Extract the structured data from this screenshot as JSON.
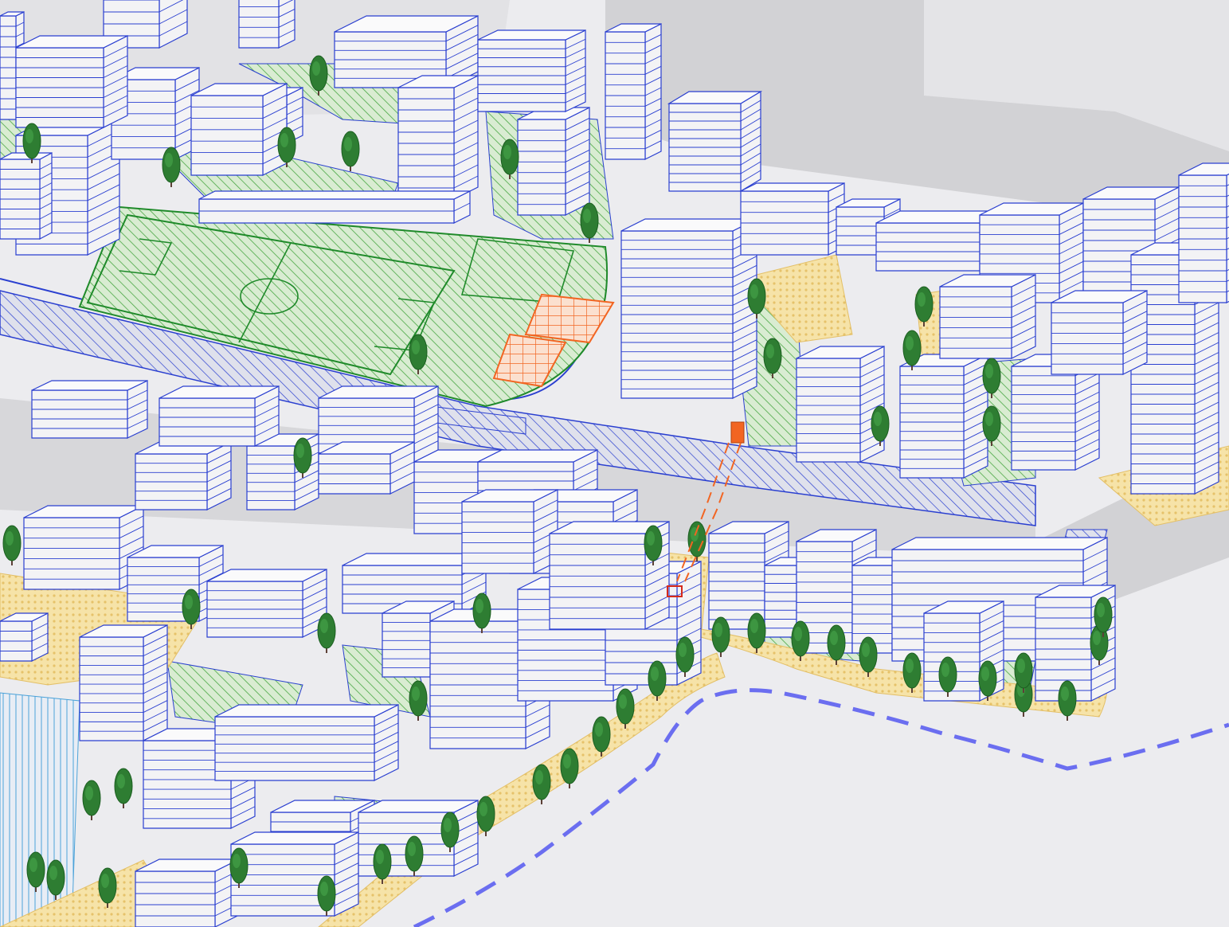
{
  "title": "",
  "colors": {
    "background": "#ececef",
    "ground_shadow": "#c9c9cc",
    "building_fill": "#f3f3f5",
    "building_roof": "#fafafb",
    "building_line": "#2a3fd0",
    "park_fill": "#d9ecd2",
    "park_hatch": "#3fa33a",
    "field_line": "#1f8a2a",
    "plaza_fill": "#f6e3a8",
    "plaza_pattern": "#e9c66a",
    "road_hatch": "#2a3fd0",
    "accent_orange": "#f26522",
    "tree_crown": "#2e7d32",
    "tree_trunk": "#5d4037",
    "river_path": "#6b6ef0"
  },
  "layers": [
    {
      "id": "shadows",
      "icon": "shadow-layer"
    },
    {
      "id": "streets",
      "icon": "road-hatch"
    },
    {
      "id": "parks",
      "icon": "green-hatch"
    },
    {
      "id": "sports_field",
      "icon": "football-pitch"
    },
    {
      "id": "plazas",
      "icon": "paving-pattern"
    },
    {
      "id": "buildings",
      "icon": "building-block"
    },
    {
      "id": "trees",
      "icon": "tree-icon"
    },
    {
      "id": "transit_link",
      "icon": "orange-dashed-link"
    },
    {
      "id": "river_path",
      "icon": "blue-dashed-path"
    }
  ]
}
